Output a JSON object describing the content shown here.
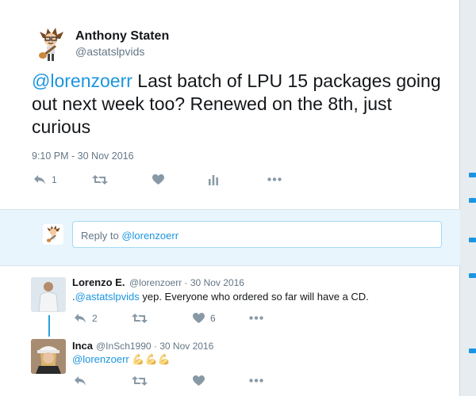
{
  "main_tweet": {
    "author_name": "Anthony Staten",
    "author_handle": "@astatslpvids",
    "avatar_icon": "cartoon-guitarist-avatar",
    "mention": "@lorenzoerr",
    "text": " Last batch of LPU 15 packages going out next week too? Renewed on the 8th, just curious",
    "timestamp": "9:10 PM - 30 Nov 2016",
    "reply_count": "1",
    "icons": [
      "reply-icon",
      "retweet-icon",
      "like-icon",
      "analytics-icon",
      "more-icon"
    ]
  },
  "reply_box": {
    "prefix": "Reply to ",
    "mention": "@lorenzoerr"
  },
  "replies": [
    {
      "name": "Lorenzo E.",
      "handle": "@lorenzoerr",
      "date": " · 30 Nov 2016",
      "text_prefix": ".",
      "mention": "@astatslpvids",
      "text": " yep. Everyone who ordered so far will have a CD.",
      "reply_count": "2",
      "like_count": "6",
      "avatar_icon": "person-photo-avatar"
    },
    {
      "name": "Inca",
      "handle": "@InSch1990",
      "date": " · 30 Nov 2016",
      "mention": "@lorenzoerr",
      "emoji": "💪💪💪",
      "avatar_icon": "person-photo-avatar"
    }
  ],
  "colors": {
    "link": "#1b95e0",
    "action_icon": "#8899a6",
    "reply_band": "#e8f5fd",
    "thread_line": "#29a0e0"
  }
}
